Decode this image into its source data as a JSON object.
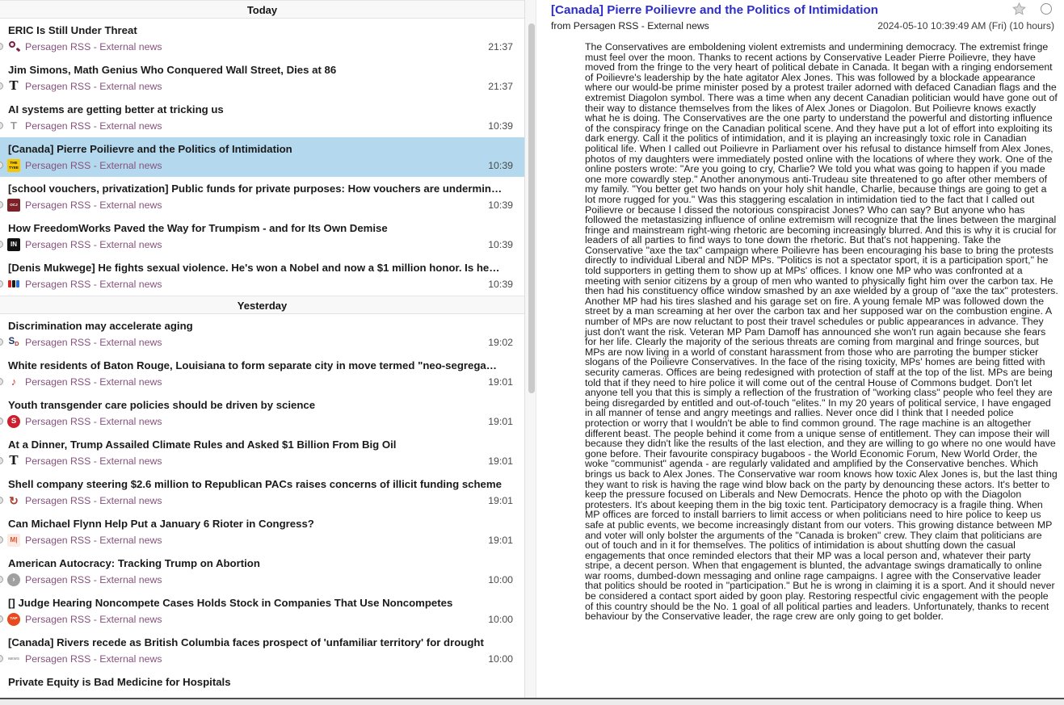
{
  "left_pane": {
    "groups": [
      {
        "label": "Today",
        "items": [
          {
            "title": "ERIC Is Still Under Threat",
            "source": "Persagen RSS - External news",
            "time": "21:37",
            "selected": false,
            "icon": {
              "name": "magnifier-favicon",
              "type": "magnifier",
              "color": "#7a2048"
            }
          },
          {
            "title": "Jim Simons, Math Genius Who Conquered Wall Street, Dies at 86",
            "source": "Persagen RSS - External news",
            "time": "21:37",
            "selected": false,
            "icon": {
              "name": "nytimes-favicon",
              "type": "char",
              "text": "T",
              "color": "#1a1a1a",
              "serif": true
            }
          },
          {
            "title": "AI systems are getting better at tricking us",
            "source": "Persagen RSS - External news",
            "time": "10:39",
            "selected": false,
            "icon": {
              "name": "letter-t-favicon",
              "type": "char",
              "text": "T",
              "color": "#9b9b9b"
            }
          },
          {
            "title": "[Canada] Pierre Poilievre and the Politics of Intimidation",
            "source": "Persagen RSS - External news",
            "time": "10:39",
            "selected": true,
            "icon": {
              "name": "tyee-favicon",
              "type": "box",
              "bg": "#f6c700",
              "fg": "#111111",
              "text": "THE TYEE",
              "small": true
            }
          },
          {
            "title": "[school vouchers, privatization] Public funds for private purposes: How vouchers are undermin…",
            "source": "Persagen RSS - External news",
            "time": "10:39",
            "selected": false,
            "icon": {
              "name": "ocj-favicon",
              "type": "box",
              "bg": "#7c2128",
              "fg": "#ffffff",
              "text": "OCJ",
              "small": true
            }
          },
          {
            "title": "How FreedomWorks Paved the Way for Trumpism - and for Its Own Demise",
            "source": "Persagen RSS - External news",
            "time": "10:39",
            "selected": false,
            "icon": {
              "name": "intercept-favicon",
              "type": "box",
              "bg": "#101010",
              "fg": "#ffffff",
              "text": "IN"
            }
          },
          {
            "title": "[Denis Mukwege] He fights sexual violence. He's won a Nobel and now a $1 million honor. Is he…",
            "source": "Persagen RSS - External news",
            "time": "10:39",
            "selected": false,
            "icon": {
              "name": "npr-favicon",
              "type": "squares",
              "colors": [
                "#d62021",
                "#1b1b1b",
                "#2f6fd8"
              ]
            }
          }
        ]
      },
      {
        "label": "Yesterday",
        "items": [
          {
            "title": "Discrimination may accelerate aging",
            "source": "Persagen RSS - External news",
            "time": "19:02",
            "selected": false,
            "icon": {
              "name": "sciencedaily-favicon",
              "type": "sd",
              "main": "S",
              "sub": "D",
              "mainColor": "#23356f",
              "subColor": "#b5342f"
            }
          },
          {
            "title": "White residents of Baton Rouge, Louisiana to form separate city in move termed \"neo-segrega…",
            "source": "Persagen RSS - External news",
            "time": "19:01",
            "selected": false,
            "icon": {
              "name": "note-glyph-favicon",
              "type": "char",
              "text": "♪",
              "color": "#c0392b"
            }
          },
          {
            "title": "Youth transgender care policies should be driven by science",
            "source": "Persagen RSS - External news",
            "time": "19:01",
            "selected": false,
            "icon": {
              "name": "sbm-favicon",
              "type": "circle",
              "bg": "#cc1f2e",
              "fg": "#ffffff",
              "text": "S"
            }
          },
          {
            "title": "At a Dinner, Trump Assailed Climate Rules and Asked $1 Billion From Big Oil",
            "source": "Persagen RSS - External news",
            "time": "19:01",
            "selected": false,
            "icon": {
              "name": "nytimes-favicon",
              "type": "char",
              "text": "T",
              "color": "#1a1a1a",
              "serif": true
            }
          },
          {
            "title": "Shell company steering $2.6 million to Republican PACs raises concerns of illicit funding scheme",
            "source": "Persagen RSS - External news",
            "time": "19:01",
            "selected": false,
            "icon": {
              "name": "opensecrets-favicon",
              "type": "char",
              "text": "↻",
              "color": "#b03a2e",
              "bold": true
            }
          },
          {
            "title": "Can Michael Flynn Help Put a January 6 Rioter in Congress?",
            "source": "Persagen RSS - External news",
            "time": "19:01",
            "selected": false,
            "icon": {
              "name": "motherjones-favicon",
              "type": "box",
              "bg": "#fbeae3",
              "fg": "#e8491f",
              "text": "M|"
            }
          },
          {
            "title": "American Autocracy: Tracking Trump on Abortion",
            "source": "Persagen RSS - External news",
            "time": "10:00",
            "selected": false,
            "icon": {
              "name": "play-circle-favicon",
              "type": "circle",
              "bg": "#a0a0a0",
              "fg": "#ffffff",
              "text": "›"
            }
          },
          {
            "title": "[] Judge Hearing Noncompete Cases Holds Stock in Companies That Use Noncompetes",
            "source": "Persagen RSS - External news",
            "time": "10:00",
            "selected": false,
            "icon": {
              "name": "tap-favicon",
              "type": "circle",
              "bg": "#e8491f",
              "fg": "#ffffff",
              "text": "TAP",
              "small": true
            }
          },
          {
            "title": "[Canada] Rivers recede as British Columbia faces prospect of 'unfamiliar territory' for drought",
            "source": "Persagen RSS - External news",
            "time": "10:00",
            "selected": false,
            "icon": {
              "name": "news-favicon",
              "type": "box",
              "bg": "#ffffff",
              "fg": "#8a93a2",
              "text": "NEWS",
              "small": true
            }
          },
          {
            "title": "Private Equity is Bad Medicine for Hospitals",
            "source": "",
            "time": "",
            "selected": false,
            "icon": null
          }
        ]
      }
    ]
  },
  "article": {
    "title": "[Canada] Pierre Poilievre and the Politics of Intimidation",
    "source_line": "from Persagen RSS - External news",
    "datetime": "2024-05-10 10:39:49 AM (Fri) (10 hours)",
    "body": "The Conservatives are emboldening violent extremists and undermining democracy. The extremist fringe must feel over the moon. Thanks to recent actions by Conservative Leader Pierre Poilievre, they have moved from the fringe to the very heart of political debate in Canada. It began with a ringing endorsement of Poilievre's leadership by the hate agitator Alex Jones. This was followed by a blockade appearance where our would-be prime minister posed by a protest trailer adorned with defaced Canadian flags and the extremist Diagolon symbol. There was a time when any decent Canadian politician would have gone out of their way to distance themselves from the likes of Alex Jones or Diagolon. But Poilievre knows exactly what he is doing. The Conservatives are the one party to understand the powerful and distorting influence of the conspiracy fringe on the Canadian political scene. And they have put a lot of effort into exploiting its dark energy. Call it the politics of intimidation, and it is playing an increasingly toxic role in Canadian political life. When I called out Poilievre in Parliament over his refusal to distance himself from Alex Jones, photos of my daughters were immediately posted online with the locations of where they work. One of the online posters wrote: \"Are you going to cry, Charlie? We told you what was going to happen if you made one more cowardly step.\" Another anonymous anti-Trudeau site threatened to go after other members of my family. \"You better get two hands on your holy shit handle, Charlie, because things are going to get a lot more rugged for you.\" Was this staggering escalation in intimidation tied to the fact that I called out Poilievre or because I dissed the notorious conspiracist Jones? Who can say? But anyone who has followed the metastasizing influence of online extremism will recognize that the lines between the marginal fringe and mainstream right-wing rhetoric are becoming increasingly blurred. And this is why it is crucial for leaders of all parties to find ways to tone down the rhetoric. But that's not happening. Take the Conservative \"axe the tax\" campaign where Poilievre has been encouraging his base to bring the protests directly to individual Liberal and NDP MPs. \"Politics is not a spectator sport, it is a participation sport,\" he told supporters in getting them to show up at MPs' offices. I know one MP who was confronted at a meeting with senior citizens by a group of men who wanted to physically fight him over the carbon tax. He then had his constituency office window smashed by an axe wielded by a group of \"axe the tax\" protesters. Another MP had his tires slashed and his garage set on fire. A young female MP was followed down the street by a man screaming at her over the carbon tax and her supposed war on the combustion engine. A number of MPs are now reluctant to post their travel schedules or public appearances in advance. They just don't want the risk. Veteran MP Pam Damoff has announced she won't run again because she fears for her life. Clearly the majority of the serious threats are coming from marginal and fringe sources, but MPs are now living in a world of constant harassment from those who are parroting the bumper sticker slogans of the Poilievre Conservatives. In the face of the rising toxicity, MPs' homes are being fitted with security cameras. Offices are being redesigned with protection of staff at the top of the list. MPs are being told that if they need to hire police it will come out of the central House of Commons budget. Don't let anyone tell you that this is simply a reflection of the frustration of \"working class\" people who feel they are being disregarded by entitled and out-of-touch \"elites.\" In my 20 years of political service, I have engaged in all manner of tense and angry meetings and rallies. Never once did I think that I needed police protection or worry that I wouldn't be able to find common ground. The rage machine is an altogether different beast. The people behind it come from a unique sense of entitlement. They can impose their will because they didn't like the results of the last election, and they are willing to go where no one would have gone before. Their favourite conspiracy bugaboos - the World Economic Forum, New World Order, the woke \"communist\" agenda - are regularly validated and amplified by the Conservative benches. Which brings us back to Alex Jones. The Conservative war room knows how toxic Alex Jones is, but the last thing they want to risk is having the rage wind blow back on the party by denouncing these actors. It's better to keep the pressure focused on Liberals and New Democrats. Hence the photo op with the Diagolon protesters. It's about keeping them in the big toxic tent. Participatory democracy is a fragile thing. When MP offices are forced to install barriers to limit access or when politicians need to hire police to keep us safe at public events, we become increasingly distant from our voters. This growing distance between MP and voter will only bolster the arguments of the \"Canada is broken\" crew. They claim that politicians are out of touch and in it for themselves. The politics of intimidation is about shutting down the casual engagements that once reminded electors that their MP was a local person and, whatever their party stripe, a decent person. When that engagement is blunted, the advantage swings dramatically to online war rooms, dumbed-down messaging and online rage campaigns. I agree with the Conservative leader that politics should be rooted in \"participation.\" But he is wrong in claiming it is a sport. And it should never be considered a contact sport aided by goon play. Restoring respectful civic engagement with the people of this country should be the No. 1 goal of all political parties and leaders. Unfortunately, thanks to recent behaviour by the Conservative leader, the rage crew are only going to get bolder."
  },
  "colors": {
    "selected_row": "#b4d9ee",
    "article_title_link": "#2d2dcb",
    "source_label": "#86527d"
  }
}
